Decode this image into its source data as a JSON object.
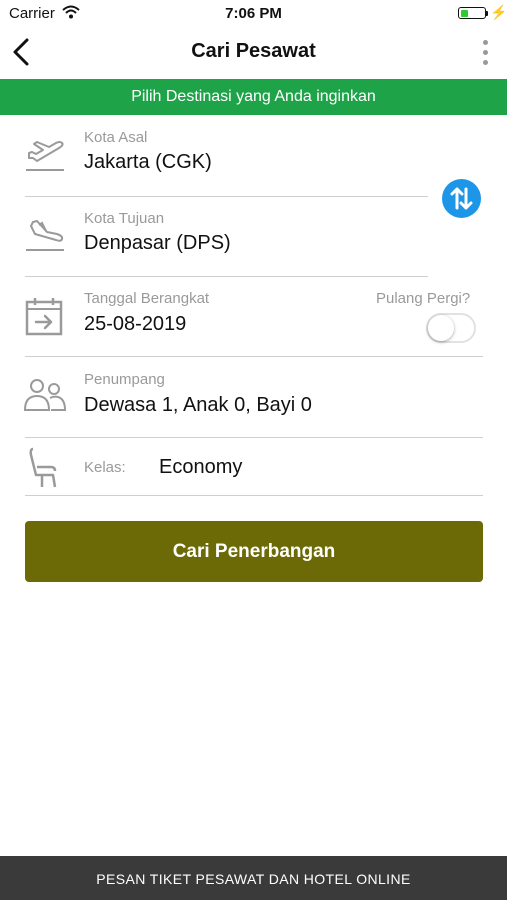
{
  "status_bar": {
    "carrier": "Carrier",
    "time": "7:06 PM",
    "battery_level": 0.3
  },
  "nav": {
    "title": "Cari Pesawat"
  },
  "banner": {
    "text": "Pilih Destinasi yang Anda inginkan"
  },
  "form": {
    "origin": {
      "label": "Kota Asal",
      "value": "Jakarta (CGK)",
      "icon": "plane-takeoff-icon"
    },
    "destination": {
      "label": "Kota Tujuan",
      "value": "Denpasar (DPS)",
      "icon": "plane-landing-icon"
    },
    "date": {
      "label": "Tanggal Berangkat",
      "value": "25-08-2019",
      "icon": "calendar-icon"
    },
    "round_trip": {
      "label": "Pulang Pergi?",
      "enabled": false
    },
    "passengers": {
      "label": "Penumpang",
      "value": "Dewasa 1, Anak 0, Bayi 0",
      "icon": "passengers-icon"
    },
    "class": {
      "label": "Kelas:",
      "value": "Economy",
      "icon": "seat-icon"
    }
  },
  "search_button": {
    "label": "Cari Penerbangan",
    "color": "#6b6a06"
  },
  "footer": {
    "text": "PESAN TIKET PESAWAT DAN HOTEL ONLINE"
  },
  "colors": {
    "banner": "#1fa349",
    "swap_button": "#1e96e8",
    "footer": "#3a3a3a"
  }
}
